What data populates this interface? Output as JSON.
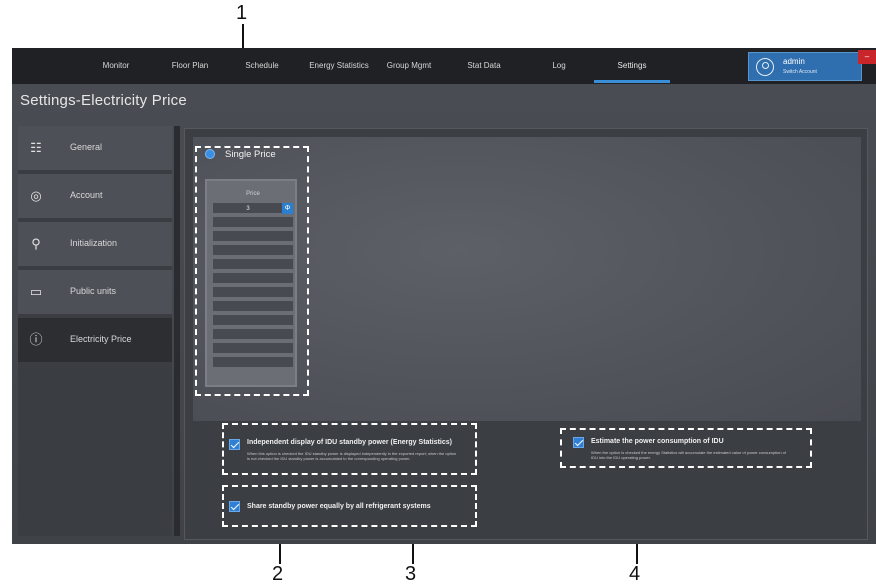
{
  "callouts": [
    "1",
    "2",
    "3",
    "4"
  ],
  "nav": {
    "items": [
      "Monitor",
      "Floor Plan",
      "Schedule",
      "Energy Statistics",
      "Group Mgmt",
      "Stat Data",
      "Log",
      "Settings"
    ],
    "active": "Settings"
  },
  "user": {
    "name": "admin",
    "switch_label": "Switch Account",
    "close_label": "–"
  },
  "page_title": "Settings-Electricity Price",
  "sidebar": {
    "items": [
      {
        "label": "General",
        "icon": "sliders-icon"
      },
      {
        "label": "Account",
        "icon": "user-circle-icon"
      },
      {
        "label": "Initialization",
        "icon": "init-search-icon"
      },
      {
        "label": "Public units",
        "icon": "units-icon"
      },
      {
        "label": "Electricity Price",
        "icon": "info-circle-icon"
      }
    ],
    "active": "Electricity Price"
  },
  "pricing": {
    "mode_label": "Single Price",
    "column_header": "Price",
    "value": "3",
    "edit_glyph": "Φ"
  },
  "options": {
    "independent_display": {
      "label": "Independent display of IDU standby power (Energy Statistics)",
      "desc": "When this option is checked the IDU standby power is displayed independently in the exported report; when the option is not checked the IDU standby power is accumulated to the corresponding operating power.",
      "checked": true
    },
    "share_standby": {
      "label": "Share standby power equally by all refrigerant systems",
      "checked": true
    },
    "estimate_power": {
      "label": "Estimate the power consumption of IDU",
      "desc": "When the option is checked the energy Statistics will accumulate the estimated value of power consumption of IDU into the IDU operating power.",
      "checked": true
    }
  },
  "colors": {
    "accent": "#2f7fd6",
    "topbar": "#1f2124",
    "close": "#c9262b"
  }
}
